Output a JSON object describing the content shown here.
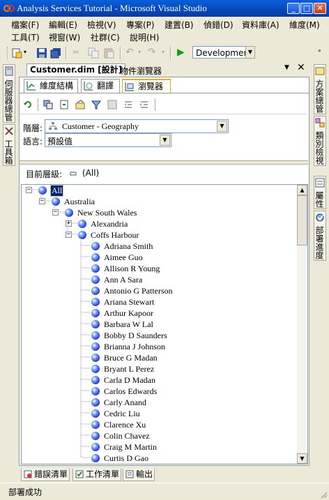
{
  "window": {
    "title": "Analysis Services Tutorial - Microsoft Visual Studio"
  },
  "menu": [
    {
      "label": "檔案(F)"
    },
    {
      "label": "編輯(E)"
    },
    {
      "label": "檢視(V)"
    },
    {
      "label": "專案(P)"
    },
    {
      "label": "建置(B)"
    },
    {
      "label": "偵錯(D)"
    },
    {
      "label": "資料庫(A)"
    },
    {
      "label": "維度(M)"
    },
    {
      "label": "工具(T)"
    },
    {
      "label": "視窗(W)"
    },
    {
      "label": "社群(C)"
    },
    {
      "label": "說明(H)"
    }
  ],
  "toolbar": {
    "configuration": "Development"
  },
  "left_panel": {
    "server_explorer": "伺服器總管",
    "toolbox": "工具箱"
  },
  "right_panel": {
    "solution_explorer": "方案總管",
    "class_view": "類別檢視",
    "properties": "屬性",
    "deployment_progress": "部署進度"
  },
  "document_tabs": [
    {
      "label": "Customer.dim [設計]",
      "active": true
    },
    {
      "label": "物件瀏覽器",
      "active": false
    }
  ],
  "designer_tabs": [
    {
      "label": "維度結構",
      "icon": "dimension-structure-icon"
    },
    {
      "label": "翻譯",
      "icon": "translation-icon"
    },
    {
      "label": "瀏覽器",
      "icon": "browser-icon"
    }
  ],
  "browser": {
    "hierarchy_label": "階層:",
    "hierarchy_value": "Customer - Geography",
    "language_label": "語言:",
    "language_value": "預設值",
    "current_level_label": "目前層級:",
    "current_level_value": "(All)"
  },
  "tree": [
    {
      "label": "All",
      "depth": 0,
      "toggle": "−",
      "selected": true
    },
    {
      "label": "Australia",
      "depth": 1,
      "toggle": "−"
    },
    {
      "label": "New South Wales",
      "depth": 2,
      "toggle": "−"
    },
    {
      "label": "Alexandria",
      "depth": 3,
      "toggle": "+"
    },
    {
      "label": "Coffs Harbour",
      "depth": 3,
      "toggle": "−"
    },
    {
      "label": "Adriana Smith",
      "depth": 4
    },
    {
      "label": "Aimee Guo",
      "depth": 4
    },
    {
      "label": "Allison R Young",
      "depth": 4
    },
    {
      "label": "Ann A Sara",
      "depth": 4
    },
    {
      "label": "Antonio G Patterson",
      "depth": 4
    },
    {
      "label": "Ariana Stewart",
      "depth": 4
    },
    {
      "label": "Arthur Kapoor",
      "depth": 4
    },
    {
      "label": "Barbara W Lal",
      "depth": 4
    },
    {
      "label": "Bobby D Saunders",
      "depth": 4
    },
    {
      "label": "Brianna J Johnson",
      "depth": 4
    },
    {
      "label": "Bruce G Madan",
      "depth": 4
    },
    {
      "label": "Bryant L Perez",
      "depth": 4
    },
    {
      "label": "Carla D Madan",
      "depth": 4
    },
    {
      "label": "Carlos Edwards",
      "depth": 4
    },
    {
      "label": "Carly Anand",
      "depth": 4
    },
    {
      "label": "Cedric Liu",
      "depth": 4
    },
    {
      "label": "Clarence Xu",
      "depth": 4
    },
    {
      "label": "Colin Chavez",
      "depth": 4
    },
    {
      "label": "Craig M Martin",
      "depth": 4
    },
    {
      "label": "Curtis D Gao",
      "depth": 4
    }
  ],
  "bottom_tabs": [
    {
      "label": "錯誤清單"
    },
    {
      "label": "工作清單"
    },
    {
      "label": "輸出"
    }
  ],
  "status": {
    "text": "部署成功"
  },
  "colors": {
    "title_bar": "#0a5fd8",
    "chrome": "#ece9d8",
    "selection": "#0a246a"
  }
}
